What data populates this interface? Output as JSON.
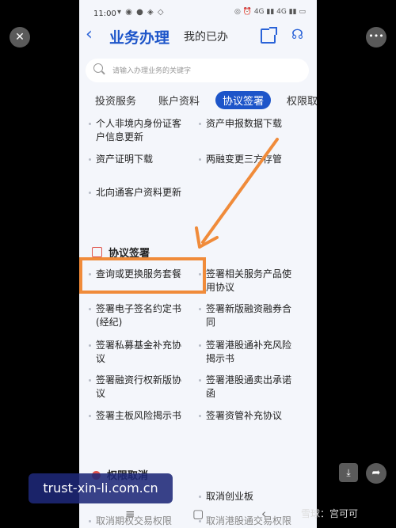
{
  "status_bar": {
    "time": "11:00",
    "icons_left": "▾ ◉ ● ◈ ◇",
    "icons_right": "◎ ⏰ 4G ▮▮ 4G ▮▮ ▭"
  },
  "header": {
    "title": "业务办理",
    "mine": "我的已办"
  },
  "search": {
    "placeholder": "请输入办理业务的关键字"
  },
  "tabs": [
    "投资服务",
    "账户资料",
    "协议签署",
    "权限取"
  ],
  "top_items": [
    [
      "个人非境内身份证客",
      "户信息更新"
    ],
    [
      "资产申报数据下载"
    ],
    [
      "资产证明下载"
    ],
    [
      "两融变更三方存管"
    ],
    [
      "北向通客户资料更新"
    ]
  ],
  "section_sign": {
    "title": "协议签署",
    "items": [
      [
        "查询或更换服务套餐"
      ],
      [
        "签署相关服务产品使",
        "用协议"
      ],
      [
        "签署电子签名约定书",
        "(经纪)"
      ],
      [
        "签署新版融资融券合",
        "同"
      ],
      [
        "签署私募基金补充协",
        "议"
      ],
      [
        "签署港股通补充风险",
        "揭示书"
      ],
      [
        "签署融资行权新版协",
        "议"
      ],
      [
        "签署港股通卖出承诺",
        "函"
      ],
      [
        "签署主板风险揭示书"
      ],
      [
        "签署资管补充协议"
      ]
    ]
  },
  "section_cancel": {
    "title": "权限取消",
    "items": [
      [
        "取消创业板"
      ]
    ],
    "partial_bottom": [
      "取消期权交易权限",
      "取消港股通交易权限"
    ]
  },
  "navbar": {
    "menu": "≡",
    "home": "▢",
    "back": "‹"
  },
  "overlay": {
    "close": "✕",
    "more": "•••",
    "download": "⤓",
    "forward": "➦",
    "watermark": "trust-xin-li.com.cn",
    "brand": "雪球：宫可可"
  }
}
